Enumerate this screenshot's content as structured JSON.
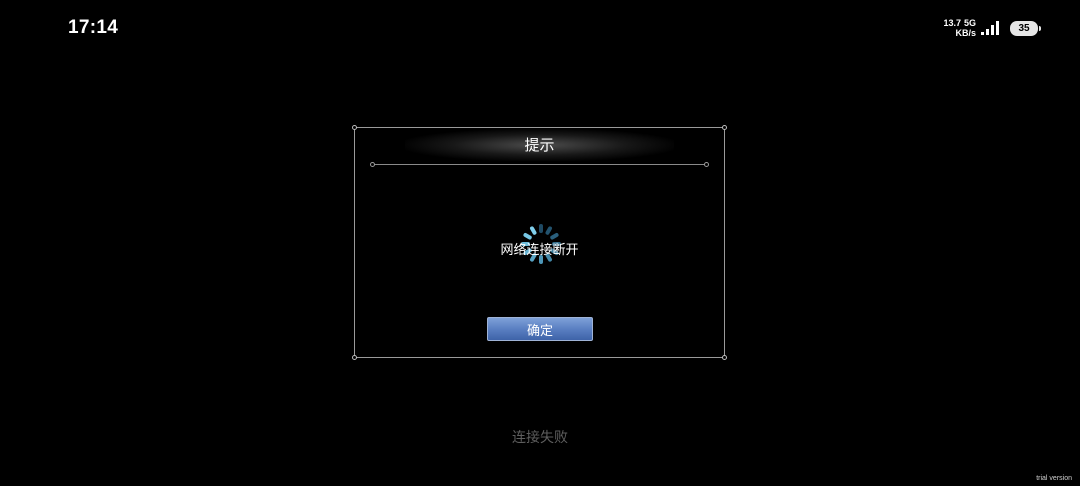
{
  "status_bar": {
    "time": "17:14",
    "net_speed_value": "13.7",
    "net_speed_unit": "KB/s",
    "network_type": "5G",
    "battery_level": "35"
  },
  "dialog": {
    "title": "提示",
    "message": "网络连接断开",
    "confirm_label": "确定",
    "accent_color": "#5a7fc2"
  },
  "bottom_status": "连接失败",
  "watermark": "trial version",
  "icons": {
    "spinner": "loading-spinner-icon",
    "signal": "cellular-signal-icon",
    "battery": "battery-icon"
  }
}
